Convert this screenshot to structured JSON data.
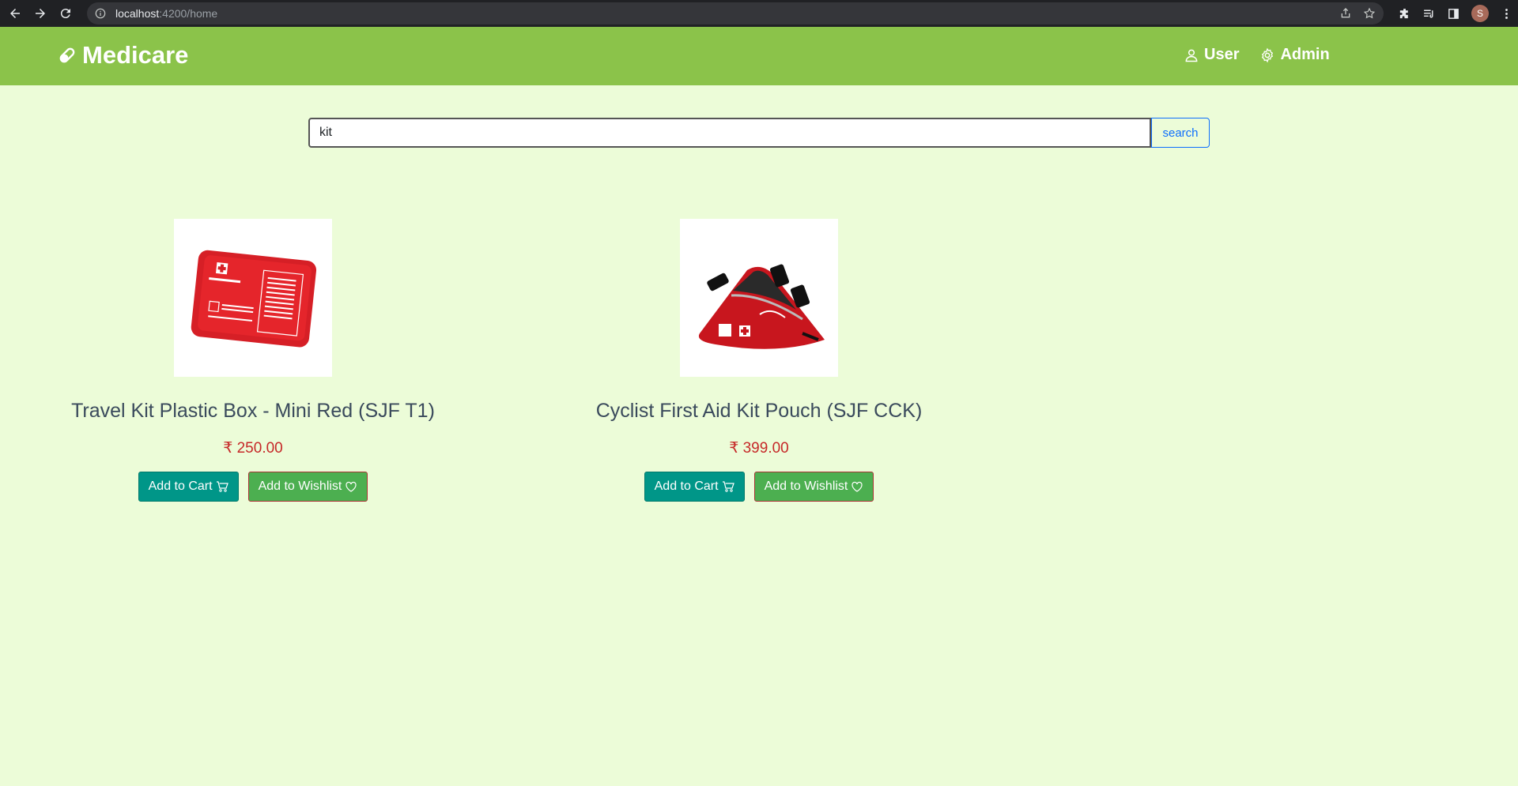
{
  "browser": {
    "url_host": "localhost",
    "url_path": ":4200/home",
    "profile_initial": "S"
  },
  "navbar": {
    "brand": "Medicare",
    "user_label": "User",
    "admin_label": "Admin",
    "bg_color": "#8bc34a"
  },
  "search": {
    "value": "kit",
    "button_label": "search"
  },
  "products": [
    {
      "name": "Travel Kit Plastic Box - Mini Red (SJF T1)",
      "price": "₹ 250.00",
      "add_to_cart": "Add to Cart",
      "add_to_wishlist": "Add to Wishlist",
      "image_icon": "first-aid-box-image"
    },
    {
      "name": "Cyclist First Aid Kit Pouch (SJF CCK)",
      "price": "₹ 399.00",
      "add_to_cart": "Add to Cart",
      "add_to_wishlist": "Add to Wishlist",
      "image_icon": "cyclist-kit-pouch-image"
    }
  ],
  "colors": {
    "page_bg": "#ecfcd8",
    "cart_button": "#009688",
    "wishlist_button": "#4caf50",
    "price": "#c62828"
  }
}
